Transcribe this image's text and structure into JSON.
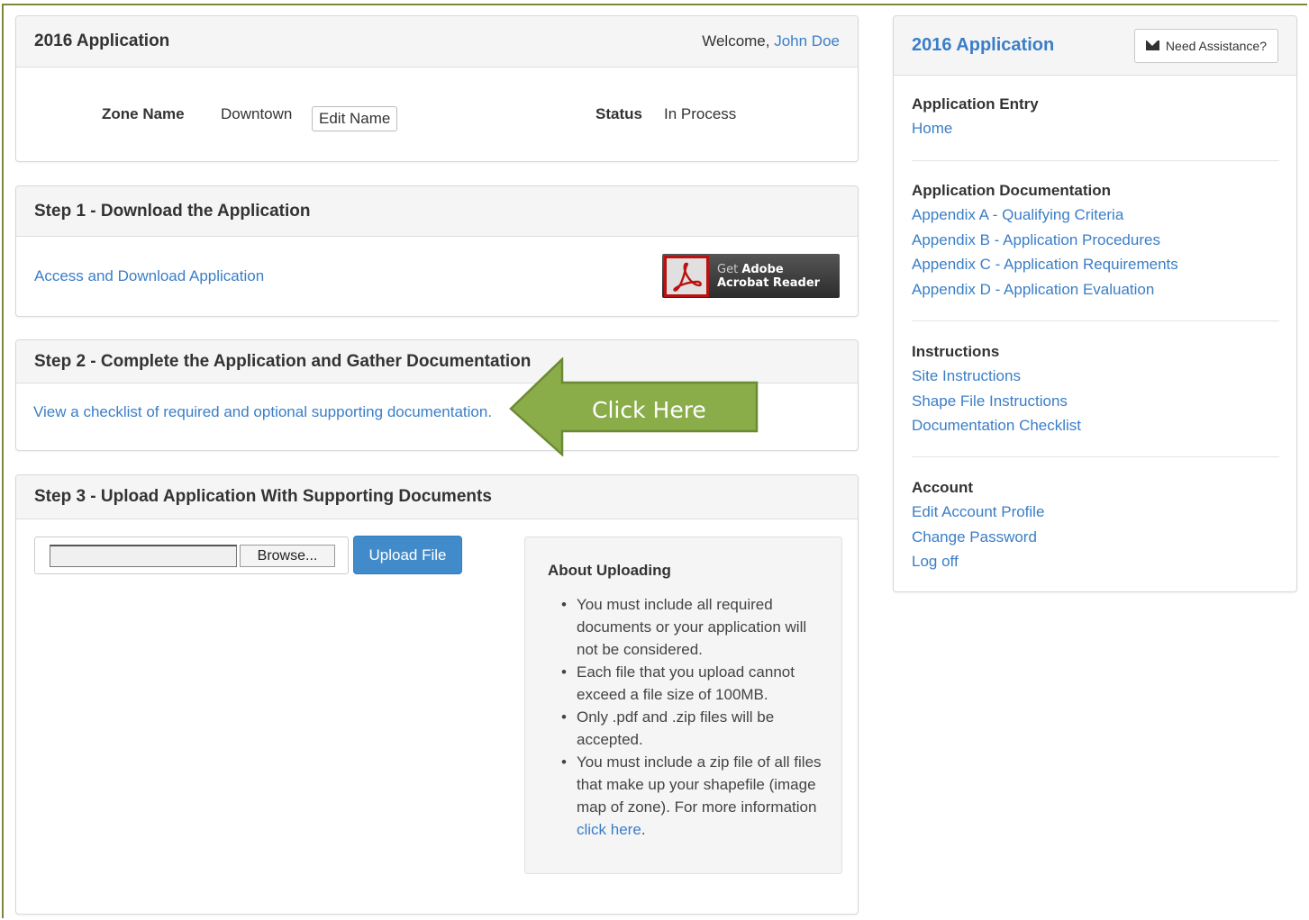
{
  "top_panel": {
    "title": "2016 Application",
    "welcome_prefix": "Welcome, ",
    "user_name": "John Doe",
    "zone_label": "Zone Name",
    "zone_value": "Downtown",
    "edit_name_label": "Edit Name",
    "status_label": "Status",
    "status_value": "In Process"
  },
  "step1": {
    "title": "Step 1 - Download the Application",
    "link": "Access and Download Application",
    "acrobat_get": "Get ",
    "acrobat_adobe": "Adobe",
    "acrobat_reader": "Acrobat Reader"
  },
  "step2": {
    "title": "Step 2 - Complete the Application and Gather Documentation",
    "link": "View a checklist of required and optional supporting documentation.",
    "callout": "Click Here"
  },
  "step3": {
    "title": "Step 3 - Upload Application With Supporting Documents",
    "browse_label": "Browse...",
    "upload_label": "Upload File",
    "about_title": "About Uploading",
    "bullets": [
      "You must include all required documents or your application will not be considered.",
      "Each file that you upload cannot exceed a file size of 100MB.",
      "Only .pdf and .zip files will be accepted."
    ],
    "bullet4_text": "You must include a zip file of all files that make up your shapefile (image map of zone). For more information ",
    "bullet4_link": "click here",
    "bullet4_end": "."
  },
  "sidebar": {
    "title": "2016 Application",
    "assist_label": "Need Assistance?",
    "sections": [
      {
        "heading": "Application Entry",
        "links": [
          "Home"
        ]
      },
      {
        "heading": "Application Documentation",
        "links": [
          "Appendix A - Qualifying Criteria",
          "Appendix B - Application Procedures",
          "Appendix C - Application Requirements",
          "Appendix D - Application Evaluation"
        ]
      },
      {
        "heading": "Instructions",
        "links": [
          "Site Instructions",
          "Shape File Instructions",
          "Documentation Checklist"
        ]
      },
      {
        "heading": "Account",
        "links": [
          "Edit Account Profile",
          "Change Password",
          "Log off"
        ]
      }
    ]
  },
  "colors": {
    "link": "#3a7ec7",
    "primary_button": "#428bca",
    "callout_arrow": "#8aad4a",
    "frame": "#7a8a3a"
  }
}
